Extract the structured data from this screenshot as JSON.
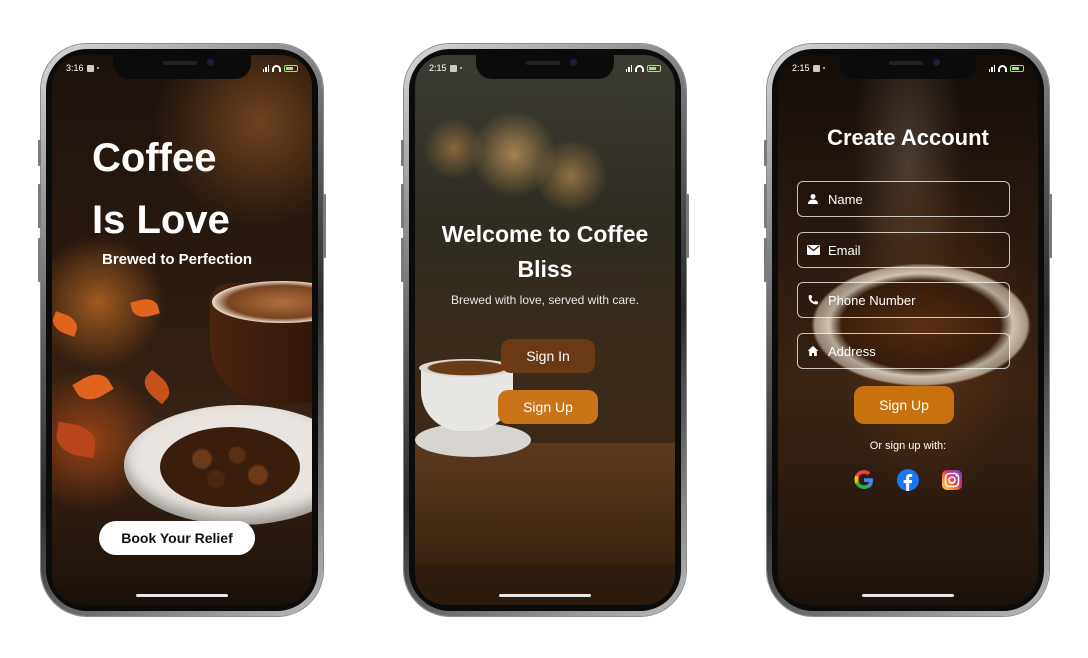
{
  "screens": [
    {
      "status_time": "3:16",
      "title_line1": "Coffee",
      "title_line2": "Is Love",
      "subtitle": "Brewed to Perfection",
      "button_label": "Book Your Relief"
    },
    {
      "status_time": "2:15",
      "title": "Welcome to Coffee Bliss",
      "subtitle": "Brewed with love, served with care.",
      "signin_label": "Sign In",
      "signup_label": "Sign Up"
    },
    {
      "status_time": "2:15",
      "title": "Create Account",
      "fields": [
        {
          "placeholder": "Name",
          "icon": "person-icon"
        },
        {
          "placeholder": "Email",
          "icon": "mail-icon"
        },
        {
          "placeholder": "Phone Number",
          "icon": "phone-icon"
        },
        {
          "placeholder": "Address",
          "icon": "home-icon"
        }
      ],
      "signup_label": "Sign Up",
      "social_prompt": "Or sign up with:",
      "social_icons": [
        "google-icon",
        "facebook-icon",
        "instagram-icon"
      ]
    }
  ],
  "colors": {
    "signin_button": "#6b3a14",
    "signup_button": "#c97418",
    "primary_text": "#ffffff"
  }
}
